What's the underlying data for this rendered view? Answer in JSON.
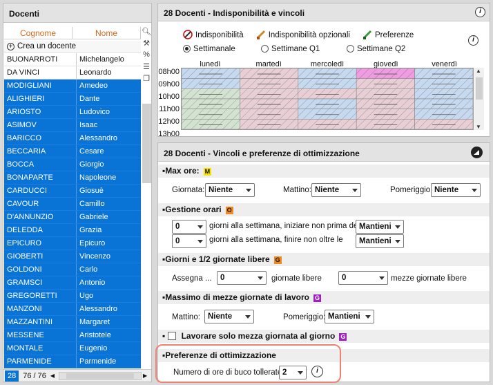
{
  "left_panel": {
    "title": "Docenti",
    "col_surname": "Cognome",
    "col_name": "Nome",
    "new_teacher": "Crea un docente",
    "rows": [
      {
        "surname": "BUONARROTI",
        "name": "Michelangelo",
        "selected": false
      },
      {
        "surname": "DA VINCI",
        "name": "Leonardo",
        "selected": false
      },
      {
        "surname": "MODIGLIANI",
        "name": "Amedeo",
        "selected": true
      },
      {
        "surname": "ALIGHIERI",
        "name": "Dante",
        "selected": true
      },
      {
        "surname": "ARIOSTO",
        "name": "Ludovico",
        "selected": true
      },
      {
        "surname": "ASIMOV",
        "name": "Isaac",
        "selected": true
      },
      {
        "surname": "BARICCO",
        "name": "Alessandro",
        "selected": true
      },
      {
        "surname": "BECCARIA",
        "name": "Cesare",
        "selected": true
      },
      {
        "surname": "BOCCA",
        "name": "Giorgio",
        "selected": true
      },
      {
        "surname": "BONAPARTE",
        "name": "Napoleone",
        "selected": true
      },
      {
        "surname": "CARDUCCI",
        "name": "Giosuè",
        "selected": true
      },
      {
        "surname": "CAVOUR",
        "name": "Camillo",
        "selected": true
      },
      {
        "surname": "D'ANNUNZIO",
        "name": "Gabriele",
        "selected": true
      },
      {
        "surname": "DELEDDA",
        "name": "Grazia",
        "selected": true
      },
      {
        "surname": "EPICURO",
        "name": "Epicuro",
        "selected": true
      },
      {
        "surname": "GIOBERTI",
        "name": "Vincenzo",
        "selected": true
      },
      {
        "surname": "GOLDONI",
        "name": "Carlo",
        "selected": true
      },
      {
        "surname": "GRAMSCI",
        "name": "Antonio",
        "selected": true
      },
      {
        "surname": "GREGORETTI",
        "name": "Ugo",
        "selected": true
      },
      {
        "surname": "MANZONI",
        "name": "Alessandro",
        "selected": true
      },
      {
        "surname": "MAZZANTINI",
        "name": "Margaret",
        "selected": true
      },
      {
        "surname": "MESSENE",
        "name": "Aristotele",
        "selected": true
      },
      {
        "surname": "MONTALE",
        "name": "Eugenio",
        "selected": true
      },
      {
        "surname": "PARMENIDE",
        "name": "Parmenide",
        "selected": true
      }
    ],
    "footer_selected": "28",
    "footer_count": "76 / 76",
    "tool_icons": [
      "search-icon",
      "wrench-icon",
      "percent-icon",
      "list-icon",
      "copy-icon"
    ]
  },
  "top_panel": {
    "title": "28 Docenti - Indisponibilità e vincoli",
    "legend": [
      "Indisponibilità",
      "Indisponibilità opzionali",
      "Preferenze"
    ],
    "radios": [
      {
        "label": "Settimanale",
        "checked": true
      },
      {
        "label": "Settimane Q1",
        "checked": false
      },
      {
        "label": "Settimane Q2",
        "checked": false
      }
    ],
    "days": [
      "lunedì",
      "martedì",
      "mercoledì",
      "giovedì",
      "venerdì"
    ],
    "hours": [
      "08h00",
      "09h00",
      "10h00",
      "11h00",
      "12h00",
      "13h00"
    ],
    "colors": {
      "blue": "#c6d9ee",
      "pink": "#e9cfd4",
      "green": "#d4e3cf",
      "magenta": "#ee9ee0"
    }
  },
  "bottom_panel": {
    "title": "28 Docenti - Vincoli e preferenze di ottimizzazione",
    "max_ore": {
      "title": "Max ore:",
      "tag": "M",
      "giornata_label": "Giornata:",
      "giornata": "Niente",
      "mattino_label": "Mattino:",
      "mattino": "Niente",
      "pomeriggio_label": "Pomeriggio:",
      "pomeriggio": "Niente"
    },
    "gestione": {
      "title": "Gestione orari",
      "tag": "O",
      "row1_num": "0",
      "row1_text": "giorni alla settimana, iniziare non prima delle",
      "row1_val": "Mantieni",
      "row2_num": "0",
      "row2_text": "giorni alla settimana, finire non oltre le",
      "row2_val": "Mantieni"
    },
    "giorni": {
      "title": "Giorni e 1/2 giornate libere",
      "tag": "G",
      "assegna": "Assegna ...",
      "val1": "0",
      "label1": "giornate libere",
      "val2": "0",
      "label2": "mezze giornate libere"
    },
    "massimo": {
      "title": "Massimo di mezze giornate di lavoro",
      "tag": "G",
      "mattino_label": "Mattino:",
      "mattino": "Niente",
      "pomeriggio_label": "Pomeriggio:",
      "pomeriggio": "Mantieni"
    },
    "lavorare": {
      "label": "Lavorare solo mezza giornata al giorno",
      "tag": "G"
    },
    "preferenze": {
      "title": "Preferenze di ottimizzazione",
      "label": "Numero di ore di buco tollerate :",
      "value": "2"
    }
  }
}
